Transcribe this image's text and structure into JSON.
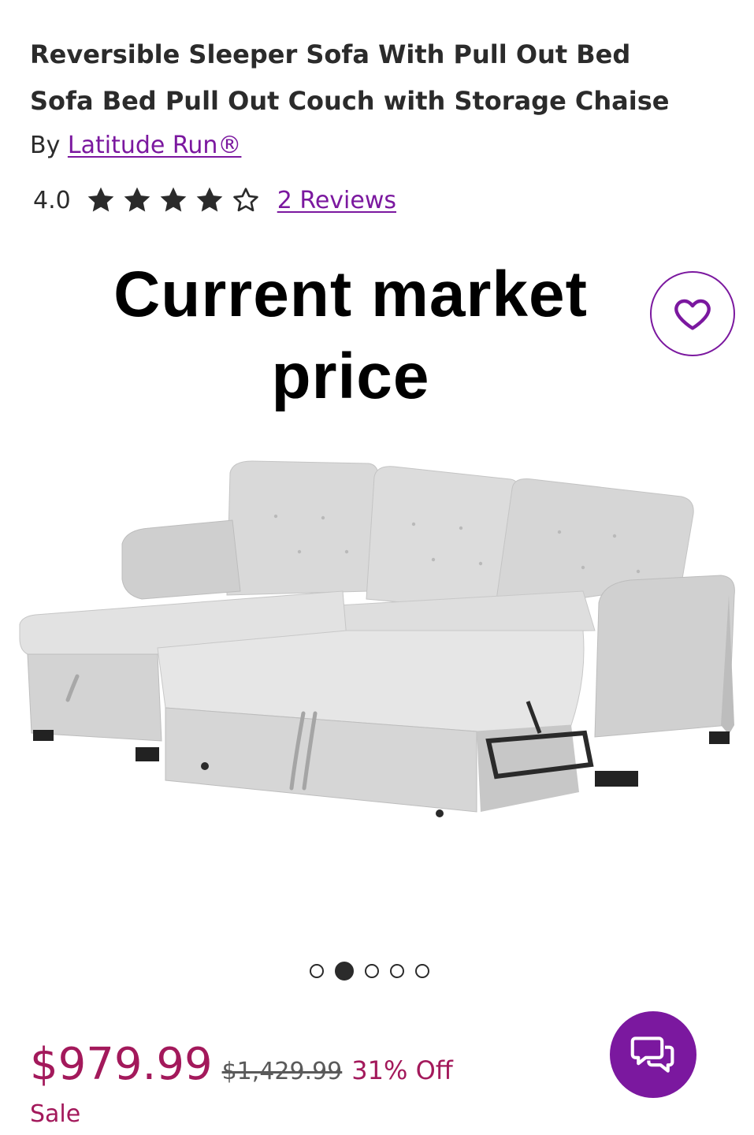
{
  "product": {
    "title_line1": "Reversible Sleeper Sofa With Pull Out Bed",
    "title_line2": "Sofa Bed Pull Out Couch with Storage Chaise",
    "by_prefix": "By",
    "brand": "Latitude Run®"
  },
  "rating": {
    "value": "4.0",
    "stars_filled": 4,
    "stars_total": 5,
    "reviews_label": "2 Reviews"
  },
  "overlay": {
    "line1": "Current market",
    "line2": "price"
  },
  "carousel": {
    "count": 5,
    "active_index": 1
  },
  "pricing": {
    "sale_price": "$979.99",
    "original_price": "$1,429.99",
    "discount": "31% Off",
    "sale_label": "Sale"
  },
  "icons": {
    "favorite": "heart-icon",
    "chat": "chat-icon",
    "star": "star-icon"
  },
  "colors": {
    "accent": "#7b189f",
    "sale": "#a3195b",
    "text": "#2b2b2b"
  }
}
